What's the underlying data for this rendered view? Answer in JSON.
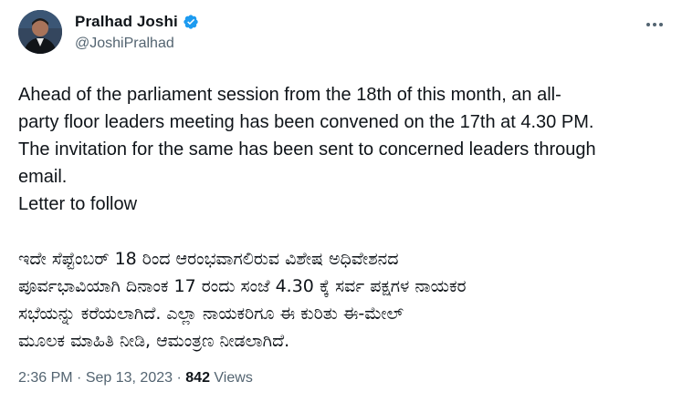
{
  "author": {
    "display_name": "Pralhad Joshi",
    "handle": "@JoshiPralhad",
    "verified_icon": "verified-badge-icon"
  },
  "tweet": {
    "english_lines": [
      "Ahead of the parliament session from the 18th of this month, an all-",
      "party floor leaders meeting has been convened on the 17th at 4.30 PM.",
      "The invitation for the same has been sent to concerned leaders through",
      "email.",
      "Letter to follow"
    ],
    "kannada_lines": [
      "ಇದೇ ಸೆಪ್ಟೆಂಬರ್ 18 ರಿಂದ ಆರಂಭವಾಗಲಿರುವ ವಿಶೇಷ ಅಧಿವೇಶನದ",
      "ಪೂರ್ವಭಾವಿಯಾಗಿ ದಿನಾಂಕ 17 ರಂದು ಸಂಜೆ 4.30 ಕ್ಕೆ ಸರ್ವ ಪಕ್ಷಗಳ ನಾಯಕರ",
      "ಸಭೆಯನ್ನು ಕರೆಯಲಾಗಿದೆ. ಎಲ್ಲಾ ನಾಯಕರಿಗೂ ಈ ಕುರಿತು ಈ-ಮೇಲ್",
      "ಮೂಲಕ ಮಾಹಿತಿ ನೀಡಿ, ಆಮಂತ್ರಣ ನೀಡಲಾಗಿದೆ."
    ]
  },
  "meta": {
    "time": "2:36 PM",
    "separator": "·",
    "date": "Sep 13, 2023",
    "views_count": "842",
    "views_label": "Views"
  },
  "colors": {
    "text_primary": "#0f1419",
    "text_secondary": "#536471",
    "verified_blue": "#1d9bf0"
  }
}
